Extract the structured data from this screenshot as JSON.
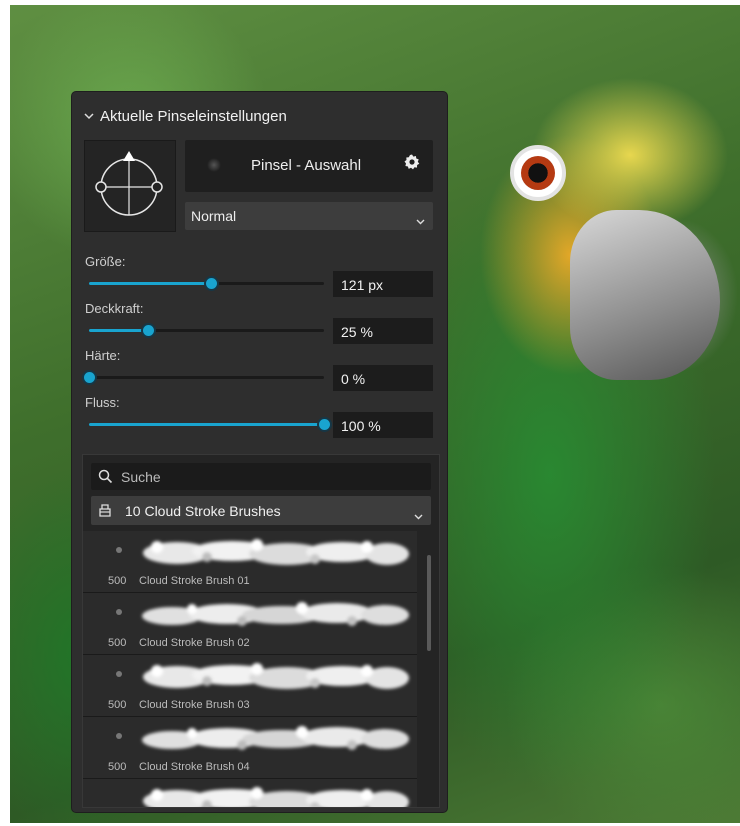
{
  "panel": {
    "title": "Aktuelle Pinseleinstellungen",
    "brush_select_label": "Pinsel - Auswahl",
    "blend_mode": "Normal"
  },
  "sliders": [
    {
      "label": "Größe:",
      "value": "121 px",
      "level": 0.52
    },
    {
      "label": "Deckkraft:",
      "value": "25 %",
      "level": 0.25
    },
    {
      "label": "Härte:",
      "value": "0 %",
      "level": 0.0
    },
    {
      "label": "Fluss:",
      "value": "100 %",
      "level": 1.0
    }
  ],
  "library": {
    "search_placeholder": "Suche",
    "category": "10 Cloud Stroke Brushes",
    "brushes": [
      {
        "size": "500",
        "name": "Cloud Stroke Brush 01"
      },
      {
        "size": "500",
        "name": "Cloud Stroke Brush 02"
      },
      {
        "size": "500",
        "name": "Cloud Stroke Brush 03"
      },
      {
        "size": "500",
        "name": "Cloud Stroke Brush 04"
      },
      {
        "size": "",
        "name": ""
      }
    ]
  },
  "colors": {
    "accent": "#19a4cf",
    "panel_bg": "#2e2e2e"
  },
  "icons": {
    "header": "chevron-down-icon",
    "settings": "gear-icon",
    "search": "search-icon",
    "category": "brush-category-icon"
  }
}
